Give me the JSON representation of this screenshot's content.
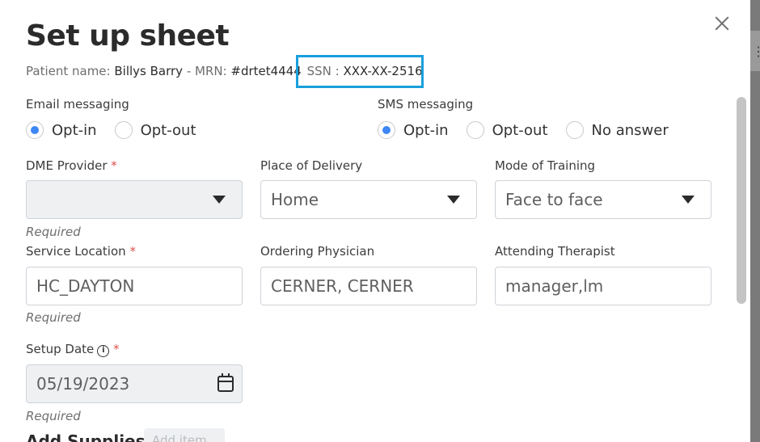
{
  "modal": {
    "title": "Set up sheet",
    "patient": {
      "name_label": "Patient name: ",
      "name_value": "Billys Barry",
      "mrn_label": " - MRN: ",
      "mrn_value": "#drtet4444",
      "ssn_label": "SSN : ",
      "ssn_value": "XXX-XX-2516"
    }
  },
  "email_messaging": {
    "label": "Email messaging",
    "options": [
      "Opt-in",
      "Opt-out"
    ],
    "selected": "Opt-in"
  },
  "sms_messaging": {
    "label": "SMS messaging",
    "options": [
      "Opt-in",
      "Opt-out",
      "No answer"
    ],
    "selected": "Opt-in"
  },
  "dme_provider": {
    "label": "DME Provider",
    "required_mark": "*",
    "value": "",
    "hint": "Required"
  },
  "place_of_delivery": {
    "label": "Place of Delivery",
    "value": "Home"
  },
  "mode_of_training": {
    "label": "Mode of Training",
    "value": "Face to face"
  },
  "service_location": {
    "label": "Service Location",
    "required_mark": "*",
    "value": "HC_DAYTON",
    "hint": "Required"
  },
  "ordering_physician": {
    "label": "Ordering Physician",
    "value": "CERNER, CERNER"
  },
  "attending_therapist": {
    "label": "Attending Therapist",
    "value": "manager,lm"
  },
  "setup_date": {
    "label": "Setup Date",
    "info_glyph": "i",
    "required_mark": "*",
    "value": "05/19/2023",
    "hint": "Required"
  },
  "supplies": {
    "title": "Add Supplies",
    "add_button": "Add item"
  },
  "icons": {
    "close": "close-icon",
    "dropdown": "chevron-down-icon",
    "calendar": "calendar-icon",
    "info": "info-icon"
  },
  "colors": {
    "accent": "#3e86f5",
    "highlight_box": "#1a9fdc",
    "required": "#d9534f"
  }
}
